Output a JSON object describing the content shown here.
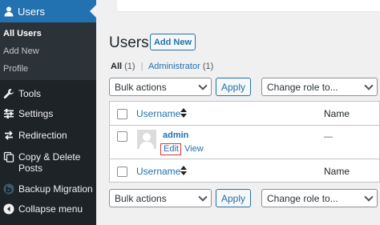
{
  "sidebar": {
    "top_item": {
      "label": "Users",
      "icon": "users-icon"
    },
    "submenu": [
      "All Users",
      "Add New",
      "Profile"
    ],
    "items": [
      {
        "label": "Tools",
        "icon": "wrench-icon"
      },
      {
        "label": "Settings",
        "icon": "settings-sliders-icon"
      },
      {
        "label": "Redirection",
        "icon": "redirection-icon"
      },
      {
        "label": "Copy & Delete",
        "label2": "Posts",
        "icon": "copy-icon"
      },
      {
        "label": "Backup Migration",
        "icon": "backup-migration-icon"
      },
      {
        "label": "Collapse menu",
        "icon": "collapse-icon"
      }
    ]
  },
  "main": {
    "title": "Users",
    "add_new": "Add New",
    "filters": {
      "all_label": "All",
      "all_count": "(1)",
      "separator": "|",
      "admin_label": "Administrator",
      "admin_count": "(1)"
    },
    "bulk_actions": "Bulk actions",
    "apply": "Apply",
    "change_role": "Change role to...",
    "table": {
      "col_username": "Username",
      "col_name": "Name",
      "row": {
        "username": "admin",
        "edit": "Edit",
        "view": "View",
        "name": "—"
      }
    }
  },
  "colors": {
    "sidebar_bg": "#1d2327",
    "accent": "#2271b1",
    "highlight_border": "#d63638"
  }
}
